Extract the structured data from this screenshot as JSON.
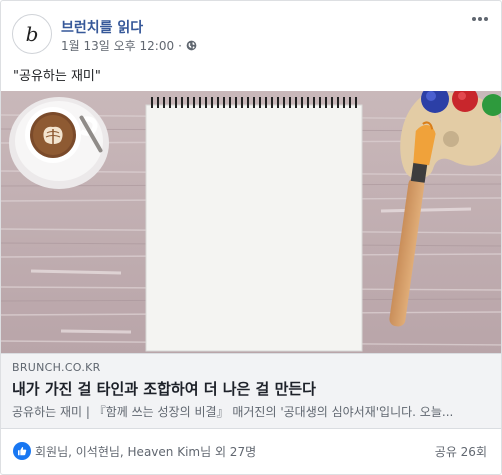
{
  "post": {
    "page_name": "브런치를 읽다",
    "avatar_glyph": "b",
    "timestamp": "1월 13일 오후 12:00",
    "dot": "·",
    "privacy_icon": "globe-icon",
    "more_icon": "more-options-icon",
    "text": "\"공유하는 재미\""
  },
  "link": {
    "domain": "BRUNCH.CO.KR",
    "title": "내가 가진 걸 타인과 조합하여 더 나은 걸 만든다",
    "description": "공유하는 재미 | 『함께 쓰는 성장의 비결』 매거진의 '공대생의 심야서재'입니다. 오늘..."
  },
  "footer": {
    "reaction_icon": "like-icon",
    "reactions_text": "회원님, 이석현님, Heaven Kim님 외 27명",
    "shares_text": "공유 26회"
  },
  "colors": {
    "page_name": "#365899",
    "like_blue": "#1877f2",
    "link_bg": "#f2f3f5"
  }
}
